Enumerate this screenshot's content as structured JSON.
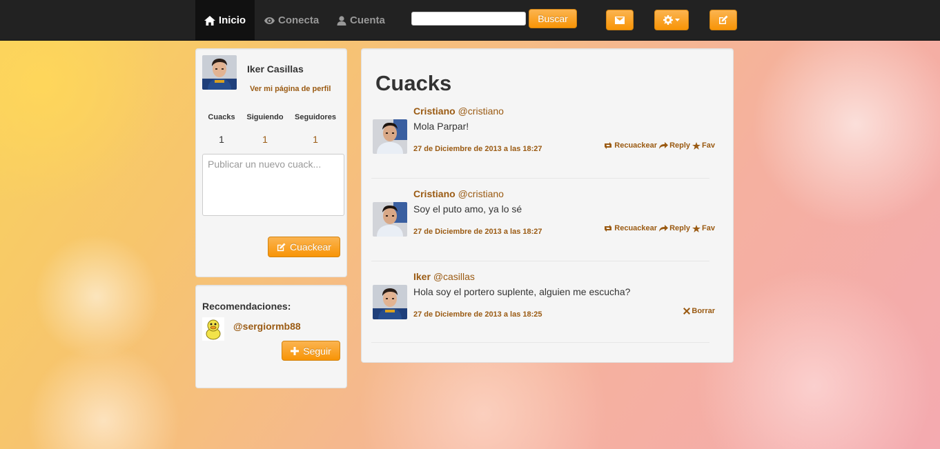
{
  "nav": {
    "home": "Inicio",
    "connect": "Conecta",
    "account": "Cuenta",
    "search_placeholder": "",
    "search_button": "Buscar"
  },
  "profile": {
    "name": "Iker Casillas",
    "profile_link": "Ver mi página de perfil",
    "stats": [
      {
        "label": "Cuacks",
        "value": "1"
      },
      {
        "label": "Siguiendo",
        "value": "1"
      },
      {
        "label": "Seguidores",
        "value": "1"
      }
    ],
    "new_cuack_placeholder": "Publicar un nuevo cuack...",
    "cuack_button": "Cuackear"
  },
  "recommendations": {
    "title": "Recomendaciones:",
    "user": "@sergiormb88",
    "follow_button": "Seguir"
  },
  "timeline": {
    "title": "Cuacks",
    "cuacks": [
      {
        "name": "Cristiano",
        "handle": "@cristiano",
        "text": "Mola Parpar!",
        "date": "27 de Diciembre de 2013 a las 18:27",
        "own": false
      },
      {
        "name": "Cristiano",
        "handle": "@cristiano",
        "text": "Soy el puto amo, ya lo sé",
        "date": "27 de Diciembre de 2013 a las 18:27",
        "own": false
      },
      {
        "name": "Iker",
        "handle": "@casillas",
        "text": "Hola soy el portero suplente, alguien me escucha?",
        "date": "27 de Diciembre de 2013 a las 18:25",
        "own": true
      }
    ],
    "actions": {
      "recuack": "Recuackear",
      "reply": "Reply",
      "fav": "Fav",
      "delete": "Borrar"
    }
  },
  "colors": {
    "accent": "#f89406",
    "link": "#9a5a12",
    "navbar": "#222222"
  }
}
